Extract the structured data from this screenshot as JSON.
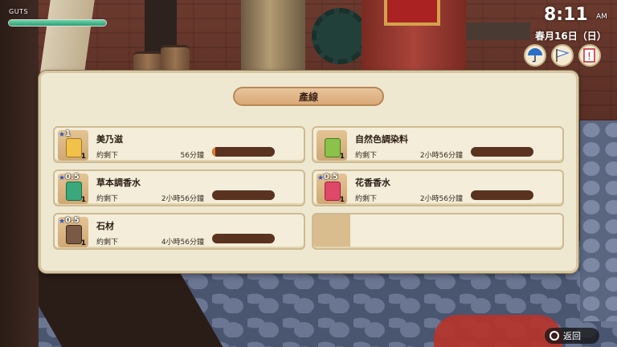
{
  "hud": {
    "guts_label": "GUTS",
    "guts_level": 1.0,
    "time": "8:11",
    "ampm": "AM",
    "date": "春月16日（日）",
    "icons": [
      "umbrella-icon",
      "windsock-icon",
      "note-icon"
    ]
  },
  "panel": {
    "title": "產線"
  },
  "items": [
    {
      "name": "美乃滋",
      "remain_label": "約剩下",
      "remain_time": "56分鐘",
      "quality": "1",
      "count": "1",
      "progress": 0.05,
      "icon": "mayonnaise-icon",
      "color": "#f2c14a"
    },
    {
      "name": "自然色調染料",
      "remain_label": "約剩下",
      "remain_time": "2小時56分鐘",
      "quality": "",
      "count": "1",
      "progress": 0.0,
      "icon": "dye-bottle-icon",
      "color": "#8ac24a"
    },
    {
      "name": "草本調香水",
      "remain_label": "約剩下",
      "remain_time": "2小時56分鐘",
      "quality": "0.5",
      "count": "1",
      "progress": 0.0,
      "icon": "herb-perfume-icon",
      "color": "#3aa87a"
    },
    {
      "name": "花香香水",
      "remain_label": "約剩下",
      "remain_time": "2小時56分鐘",
      "quality": "0.5",
      "count": "1",
      "progress": 0.0,
      "icon": "flower-perfume-icon",
      "color": "#e0486a"
    },
    {
      "name": "石材",
      "remain_label": "約剩下",
      "remain_time": "4小時56分鐘",
      "quality": "0.5",
      "count": "1",
      "progress": 0.0,
      "icon": "stone-icon",
      "color": "#7a5a44"
    }
  ],
  "footer": {
    "back_label": "返回"
  }
}
